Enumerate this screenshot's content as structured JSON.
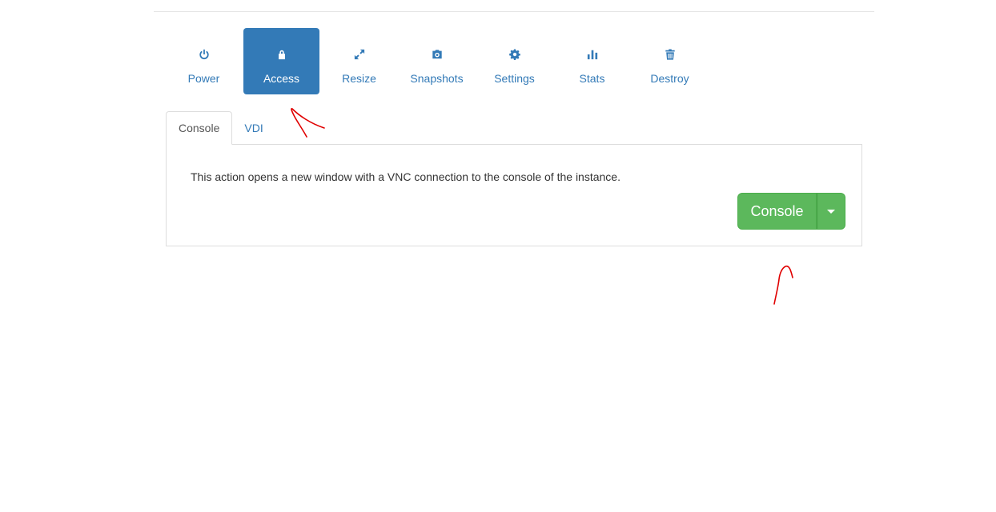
{
  "actions": [
    {
      "label": "Power",
      "icon": "power-icon"
    },
    {
      "label": "Access",
      "icon": "lock-icon",
      "active": true
    },
    {
      "label": "Resize",
      "icon": "expand-arrows-icon"
    },
    {
      "label": "Snapshots",
      "icon": "camera-icon"
    },
    {
      "label": "Settings",
      "icon": "gear-icon"
    },
    {
      "label": "Stats",
      "icon": "bar-chart-icon"
    },
    {
      "label": "Destroy",
      "icon": "trash-icon"
    }
  ],
  "sub_tabs": [
    {
      "label": "Console",
      "active": true
    },
    {
      "label": "VDI"
    }
  ],
  "panel": {
    "description": "This action opens a new window with a VNC connection to the console of the instance.",
    "button_label": "Console"
  },
  "colors": {
    "primary": "#337ab7",
    "success": "#5cb85c",
    "annotation": "#e00000"
  }
}
